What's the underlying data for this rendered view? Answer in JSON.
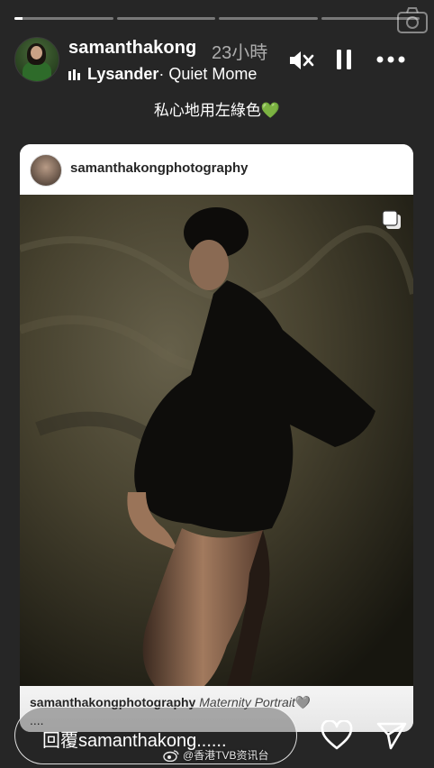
{
  "story": {
    "progress_segments": [
      1,
      0,
      0,
      0
    ],
    "current_segment_fill": 0.08
  },
  "header": {
    "username": "samanthakong",
    "time_ago": "23小時",
    "music_artist": "Lysander",
    "music_title": " · Quiet Mome"
  },
  "caption": {
    "text": "私心地用左綠色",
    "emoji": "💚"
  },
  "card": {
    "username": "samanthakongphotography",
    "caption_user": "samanthakongphotography",
    "caption_text": "Maternity Portrait",
    "caption_emoji": "🩶",
    "more": "...."
  },
  "reply": {
    "placeholder": "回覆samanthakong......"
  },
  "watermark": {
    "text": "@香港TVB资讯台"
  },
  "icons": {
    "camera": "camera-icon",
    "mute": "speaker-muted-icon",
    "pause": "pause-icon",
    "more": "more-horizontal-icon",
    "like": "heart-icon",
    "share": "send-icon",
    "multi": "multiple-photos-icon"
  },
  "colors": {
    "background": "#262626",
    "heart_green": "#2ecc40"
  }
}
